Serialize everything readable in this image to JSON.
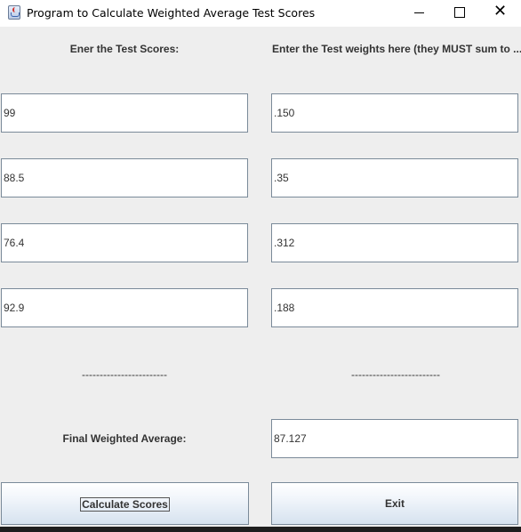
{
  "window": {
    "title": "Program to Calculate Weighted Average Test Scores",
    "controls": {
      "minimize_icon": "minimize-icon",
      "maximize_icon": "maximize-icon",
      "close_icon": "close-icon"
    }
  },
  "labels": {
    "scores_header": "Ener the Test Scores:",
    "weights_header": "Enter the Test weights here (they MUST sum to ...",
    "separator_left": "------------------------",
    "separator_right": "-------------------------",
    "final_label": "Final Weighted Average:"
  },
  "scores": [
    "99",
    "88.5",
    "76.4",
    "92.9"
  ],
  "weights": [
    ".150",
    ".35",
    ".312",
    ".188"
  ],
  "result": {
    "final_value": "87.127"
  },
  "buttons": {
    "calculate": "Calculate Scores",
    "exit": "Exit"
  },
  "colors": {
    "window_bg": "#eeeeee",
    "field_border": "#7a8a99",
    "text": "#333333"
  }
}
